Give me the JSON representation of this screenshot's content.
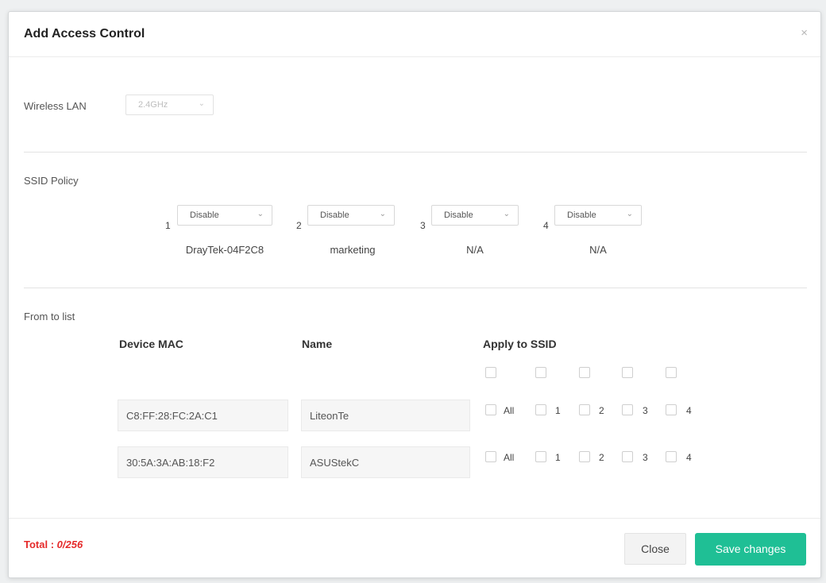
{
  "dialog": {
    "title": "Add Access Control",
    "close_icon": "×"
  },
  "wireless_lan": {
    "label": "Wireless LAN",
    "value": "2.4GHz"
  },
  "ssid_policy": {
    "label": "SSID Policy",
    "items": [
      {
        "num": "1",
        "value": "Disable",
        "name": "DrayTek-04F2C8"
      },
      {
        "num": "2",
        "value": "Disable",
        "name": "marketing"
      },
      {
        "num": "3",
        "value": "Disable",
        "name": "N/A"
      },
      {
        "num": "4",
        "value": "Disable",
        "name": "N/A"
      }
    ]
  },
  "list": {
    "label": "From to list",
    "headers": {
      "mac": "Device MAC",
      "name": "Name",
      "apply": "Apply to SSID"
    },
    "rows": [
      {
        "mac": "C8:FF:28:FC:2A:C1",
        "name": "LiteonTe",
        "opts": [
          "All",
          "1",
          "2",
          "3",
          "4"
        ]
      },
      {
        "mac": "30:5A:3A:AB:18:F2",
        "name": "ASUStekC",
        "opts": [
          "All",
          "1",
          "2",
          "3",
          "4"
        ]
      }
    ]
  },
  "footer": {
    "total_label": "Total : ",
    "total_value": "0/256",
    "close_label": "Close",
    "save_label": "Save changes",
    "save_color": "#1fbf95",
    "total_color": "#e52a2a"
  }
}
